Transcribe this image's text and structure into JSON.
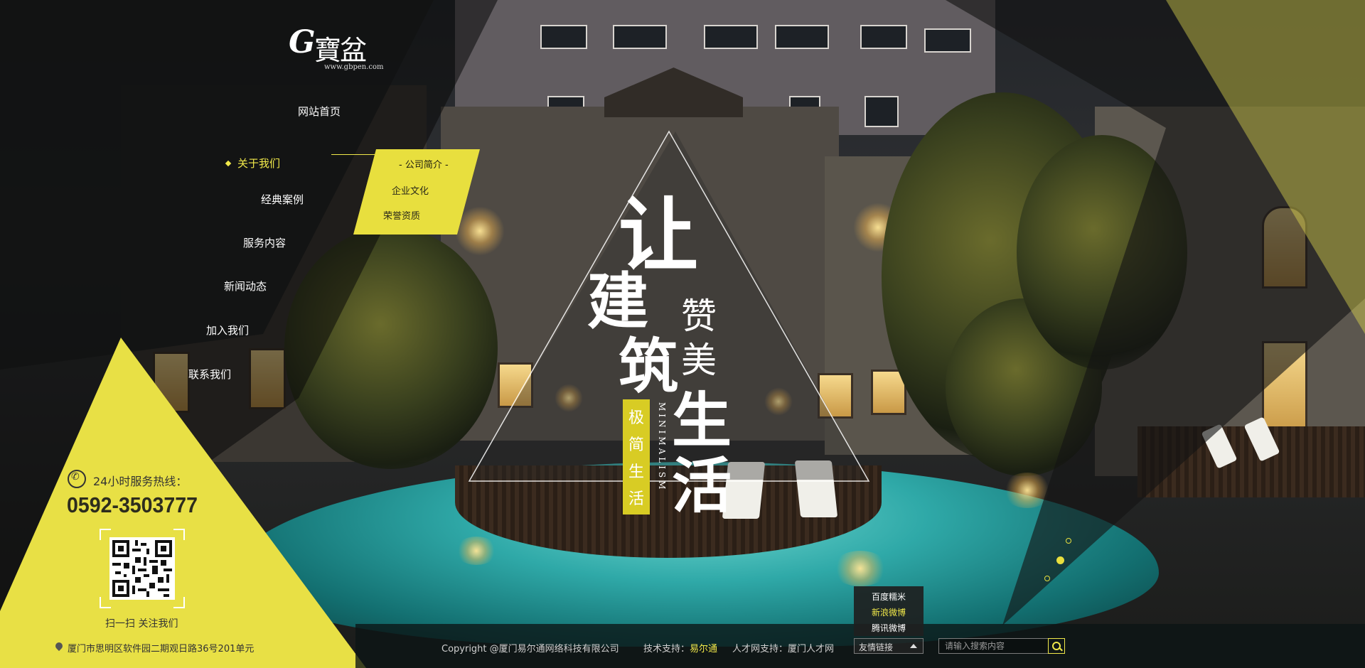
{
  "logo": {
    "mark": "G",
    "name": "寶盆",
    "url": "www.gbpen.com"
  },
  "nav": {
    "items": [
      {
        "label": "网站首页",
        "active": false
      },
      {
        "label": "关于我们",
        "active": true
      },
      {
        "label": "经典案例",
        "active": false
      },
      {
        "label": "服务内容",
        "active": false
      },
      {
        "label": "新闻动态",
        "active": false
      },
      {
        "label": "加入我们",
        "active": false
      },
      {
        "label": "联系我们",
        "active": false
      }
    ],
    "submenu": [
      {
        "label": "- 公司简介 -",
        "active": true
      },
      {
        "label": "企业文化",
        "active": false
      },
      {
        "label": "荣誉资质",
        "active": false
      }
    ]
  },
  "hero": {
    "line1": "让",
    "line2": "建",
    "line3": "筑",
    "line4": "赞",
    "line5": "美",
    "line6": "生",
    "line7": "活",
    "tag": [
      "极",
      "简",
      "生",
      "活"
    ],
    "en": "MINIMALISM"
  },
  "contact": {
    "hotline_label": "24小时服务热线：",
    "hotline_number": "0592-3503777",
    "qr_label": "扫一扫 关注我们",
    "address": "厦门市思明区软件园二期观日路36号201单元"
  },
  "footer": {
    "copyright": "Copyright @厦门易尔通网络科技有限公司",
    "tech_label": "技术支持：",
    "tech_link": "易尔通",
    "talent_label": "人才网支持：",
    "talent_link": "厦门人才网",
    "friend_select": "友情链接",
    "friend_links": [
      "百度糯米",
      "新浪微博",
      "腾讯微博"
    ],
    "search_placeholder": "请输入搜索内容"
  },
  "colors": {
    "accent": "#f1e94a",
    "yellow_panel": "#e8e045",
    "tag": "#d8cc24"
  }
}
